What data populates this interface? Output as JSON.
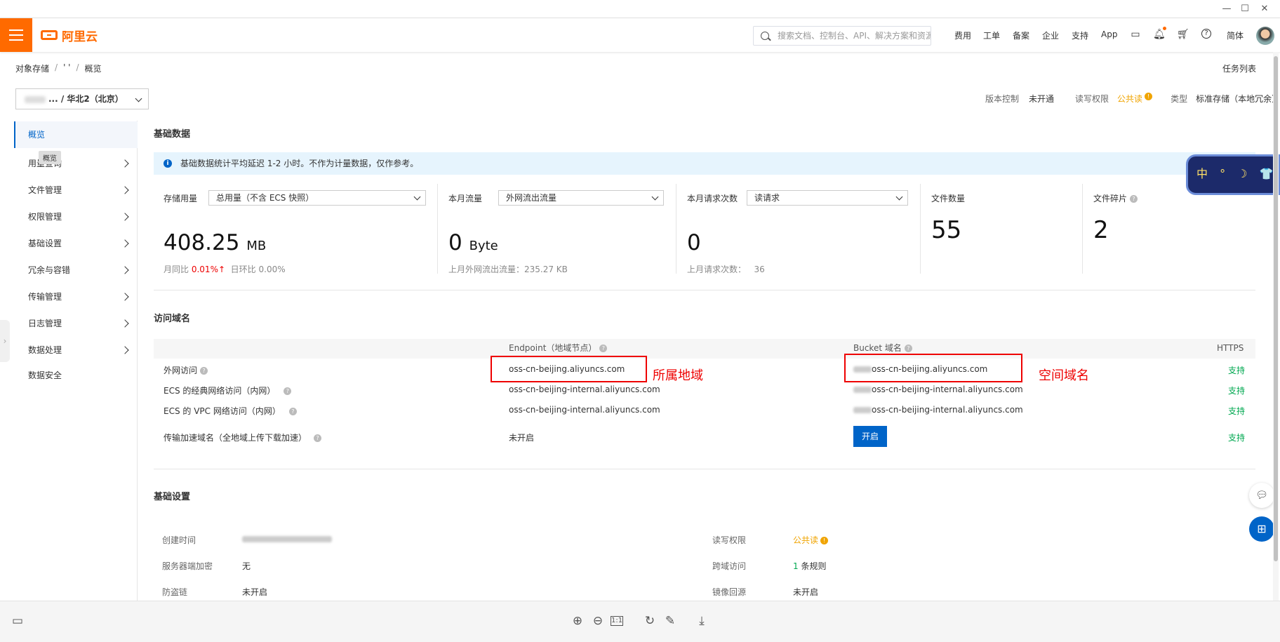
{
  "window": {
    "minimize": "—",
    "maximize": "☐",
    "close": "✕"
  },
  "topnav": {
    "brand": "阿里云",
    "search_placeholder": "搜索文档、控制台、API、解决方案和资源",
    "links": [
      "费用",
      "工单",
      "备案",
      "企业",
      "支持",
      "App"
    ],
    "lang": "简体"
  },
  "breadcrumb": {
    "root": "对象存储",
    "bucket": "' '",
    "current": "概览",
    "sep": "/"
  },
  "task_list": "任务列表",
  "region_select": {
    "value": "... / 华北2（北京）"
  },
  "meta": {
    "version_label": "版本控制",
    "version_value": "未开通",
    "rw_label": "读写权限",
    "rw_value": "公共读",
    "type_label": "类型",
    "type_value": "标准存储（本地冗余）"
  },
  "sidebar": {
    "items": [
      {
        "label": "概览"
      },
      {
        "label": "用量查询"
      },
      {
        "label": "文件管理"
      },
      {
        "label": "权限管理"
      },
      {
        "label": "基础设置"
      },
      {
        "label": "冗余与容错"
      },
      {
        "label": "传输管理"
      },
      {
        "label": "日志管理"
      },
      {
        "label": "数据处理"
      },
      {
        "label": "数据安全"
      }
    ],
    "tooltip": "概览"
  },
  "basic_data": {
    "title": "基础数据",
    "notice": "基础数据统计平均延迟 1-2 小时。不作为计量数据，仅作参考。",
    "storage": {
      "label": "存储用量",
      "dropdown": "总用量（不含 ECS 快照）",
      "value": "408.25",
      "unit": "MB",
      "yoy_label": "月同比",
      "yoy_value": "0.01%↑",
      "mom_label": "日环比",
      "mom_value": "0.00%"
    },
    "traffic": {
      "label": "本月流量",
      "dropdown": "外网流出流量",
      "value": "0",
      "unit": "Byte",
      "sub": "上月外网流出流量：235.27 KB"
    },
    "requests": {
      "label": "本月请求次数",
      "dropdown": "读请求",
      "value": "0",
      "sub_label": "上月请求次数：",
      "sub_value": "36"
    },
    "files": {
      "label": "文件数量",
      "value": "55"
    },
    "fragments": {
      "label": "文件碎片",
      "value": "2"
    }
  },
  "domains": {
    "title": "访问域名",
    "headers": {
      "endpoint": "Endpoint（地域节点）",
      "bucket": "Bucket 域名",
      "https": "HTTPS"
    },
    "rows": [
      {
        "name": "外网访问",
        "endpoint": "oss-cn-beijing.aliyuncs.com",
        "bucket": "oss-cn-beijing.aliyuncs.com",
        "https": "支持"
      },
      {
        "name": "ECS 的经典网络访问（内网）",
        "endpoint": "oss-cn-beijing-internal.aliyuncs.com",
        "bucket": "oss-cn-beijing-internal.aliyuncs.com",
        "https": "支持"
      },
      {
        "name": "ECS 的 VPC 网络访问（内网）",
        "endpoint": "oss-cn-beijing-internal.aliyuncs.com",
        "bucket": "oss-cn-beijing-internal.aliyuncs.com",
        "https": "支持"
      },
      {
        "name": "传输加速域名（全地域上传下载加速）",
        "endpoint": "未开启",
        "bucket_button": "开启",
        "https": "支持"
      }
    ],
    "annot_region": "所属地域",
    "annot_bucket": "空间域名"
  },
  "basic_settings": {
    "title": "基础设置",
    "created_label": "创建时间",
    "sse_label": "服务器端加密",
    "sse_value": "无",
    "hotlink_label": "防盗链",
    "hotlink_value": "未开启",
    "rw_label": "读写权限",
    "rw_value": "公共读",
    "cors_label": "跨域访问",
    "cors_count": "1",
    "cors_unit": "条规则",
    "mirror_label": "镜像回源",
    "mirror_value": "未开启"
  },
  "widget": {
    "text": "中 ° ☽ 👕 ⭐"
  },
  "colors": {
    "accent": "#ff6a00",
    "primary": "#0064c8",
    "success": "#00a850",
    "warning": "#f0a400",
    "annotation": "#e00000"
  }
}
